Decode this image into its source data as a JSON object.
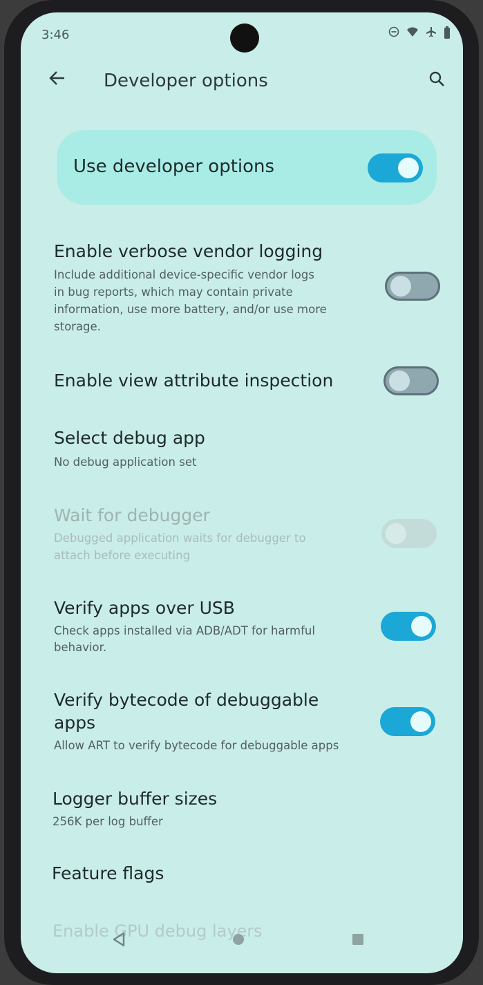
{
  "status_bar": {
    "time": "3:46",
    "icons": [
      "dnd-icon",
      "wifi-icon",
      "airplane-icon",
      "battery-icon"
    ]
  },
  "header": {
    "title": "Developer options",
    "back_icon": "arrow-left-icon",
    "search_icon": "search-icon"
  },
  "master_switch": {
    "label": "Use developer options",
    "state": "on"
  },
  "settings": [
    {
      "title": "Enable verbose vendor logging",
      "subtitle_lines": [
        "Include additional device-specific vendor logs",
        "in bug reports, which may contain private",
        "information, use more battery, and/or use more",
        "storage."
      ],
      "toggle": "off"
    },
    {
      "title": "Enable view attribute inspection",
      "toggle": "off"
    },
    {
      "title": "Select debug app",
      "subtitle": "No debug application set"
    },
    {
      "title": "Wait for debugger",
      "subtitle_lines": [
        "Debugged application waits for debugger to",
        "attach before executing"
      ],
      "toggle": "disabled"
    },
    {
      "title": "Verify apps over USB",
      "subtitle_lines": [
        "Check apps installed via ADB/ADT for harmful",
        "behavior."
      ],
      "toggle": "on"
    },
    {
      "title_lines": [
        "Verify bytecode of debuggable",
        "apps"
      ],
      "subtitle": "Allow ART to verify bytecode for debuggable apps",
      "toggle": "on"
    },
    {
      "title": "Logger buffer sizes",
      "subtitle": "256K per log buffer"
    },
    {
      "title": "Feature flags"
    }
  ],
  "nav_bar": {
    "ghost_text": "Enable GPU debug layers",
    "back": "triangle-back-icon",
    "home": "circle-home-icon",
    "recents": "square-recents-icon"
  },
  "colors": {
    "background": "#c9ede9",
    "accent": "#1ba8d6",
    "card": "#a9ece6"
  }
}
